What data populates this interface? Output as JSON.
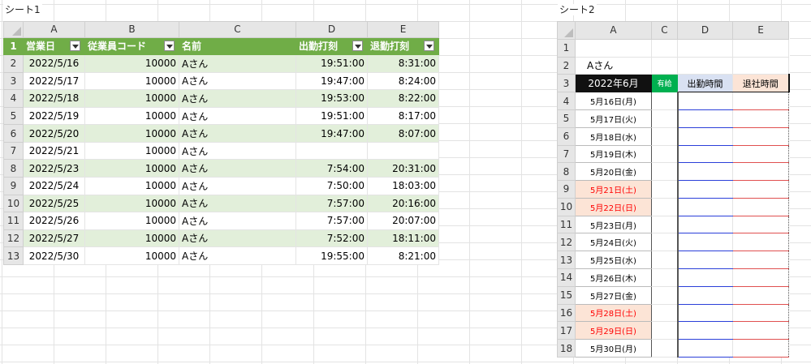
{
  "sheet1": {
    "label": "シート1",
    "columns": [
      "A",
      "B",
      "C",
      "D",
      "E"
    ],
    "headers": [
      "営業日",
      "従業員コード",
      "名前",
      "出勤打刻",
      "退勤打刻"
    ],
    "rows": [
      {
        "n": "1"
      },
      {
        "n": "2",
        "date": "2022/5/16",
        "code": "10000",
        "name": "Aさん",
        "in": "19:51:00",
        "out": "8:31:00"
      },
      {
        "n": "3",
        "date": "2022/5/17",
        "code": "10000",
        "name": "Aさん",
        "in": "19:47:00",
        "out": "8:24:00"
      },
      {
        "n": "4",
        "date": "2022/5/18",
        "code": "10000",
        "name": "Aさん",
        "in": "19:53:00",
        "out": "8:22:00"
      },
      {
        "n": "5",
        "date": "2022/5/19",
        "code": "10000",
        "name": "Aさん",
        "in": "19:51:00",
        "out": "8:17:00"
      },
      {
        "n": "6",
        "date": "2022/5/20",
        "code": "10000",
        "name": "Aさん",
        "in": "19:47:00",
        "out": "8:07:00"
      },
      {
        "n": "7",
        "date": "2022/5/21",
        "code": "10000",
        "name": "Aさん",
        "in": "",
        "out": ""
      },
      {
        "n": "8",
        "date": "2022/5/23",
        "code": "10000",
        "name": "Aさん",
        "in": "7:54:00",
        "out": "20:31:00"
      },
      {
        "n": "9",
        "date": "2022/5/24",
        "code": "10000",
        "name": "Aさん",
        "in": "7:50:00",
        "out": "18:03:00"
      },
      {
        "n": "10",
        "date": "2022/5/25",
        "code": "10000",
        "name": "Aさん",
        "in": "7:57:00",
        "out": "20:16:00"
      },
      {
        "n": "11",
        "date": "2022/5/26",
        "code": "10000",
        "name": "Aさん",
        "in": "7:57:00",
        "out": "20:07:00"
      },
      {
        "n": "12",
        "date": "2022/5/27",
        "code": "10000",
        "name": "Aさん",
        "in": "7:52:00",
        "out": "18:11:00"
      },
      {
        "n": "13",
        "date": "2022/5/30",
        "code": "10000",
        "name": "Aさん",
        "in": "19:55:00",
        "out": "8:21:00"
      }
    ]
  },
  "sheet2": {
    "label": "シート2",
    "columns": [
      "A",
      "C",
      "D",
      "E"
    ],
    "row_numbers": [
      "1",
      "2",
      "3",
      "4",
      "5",
      "6",
      "7",
      "8",
      "9",
      "10",
      "11",
      "12",
      "13",
      "14",
      "15",
      "16",
      "17",
      "18"
    ],
    "employee_name": "Aさん",
    "month": "2022年6月",
    "paid_leave": "有給",
    "in_time": "出勤時間",
    "out_time": "退社時間",
    "dates": [
      {
        "label": "5月16日(月)",
        "weekend": false
      },
      {
        "label": "5月17日(火)",
        "weekend": false
      },
      {
        "label": "5月18日(水)",
        "weekend": false
      },
      {
        "label": "5月19日(木)",
        "weekend": false
      },
      {
        "label": "5月20日(金)",
        "weekend": false
      },
      {
        "label": "5月21日(土)",
        "weekend": true
      },
      {
        "label": "5月22日(日)",
        "weekend": true
      },
      {
        "label": "5月23日(月)",
        "weekend": false
      },
      {
        "label": "5月24日(火)",
        "weekend": false
      },
      {
        "label": "5月25日(水)",
        "weekend": false
      },
      {
        "label": "5月26日(木)",
        "weekend": false
      },
      {
        "label": "5月27日(金)",
        "weekend": false
      },
      {
        "label": "5月28日(土)",
        "weekend": true
      },
      {
        "label": "5月29日(日)",
        "weekend": true
      },
      {
        "label": "5月30日(月)",
        "weekend": false
      }
    ],
    "colors": {
      "weekend_fill": "#fce4d6",
      "weekend_text": "#ff0000",
      "header_green": "#70ad47",
      "paid_green": "#00b050"
    }
  }
}
